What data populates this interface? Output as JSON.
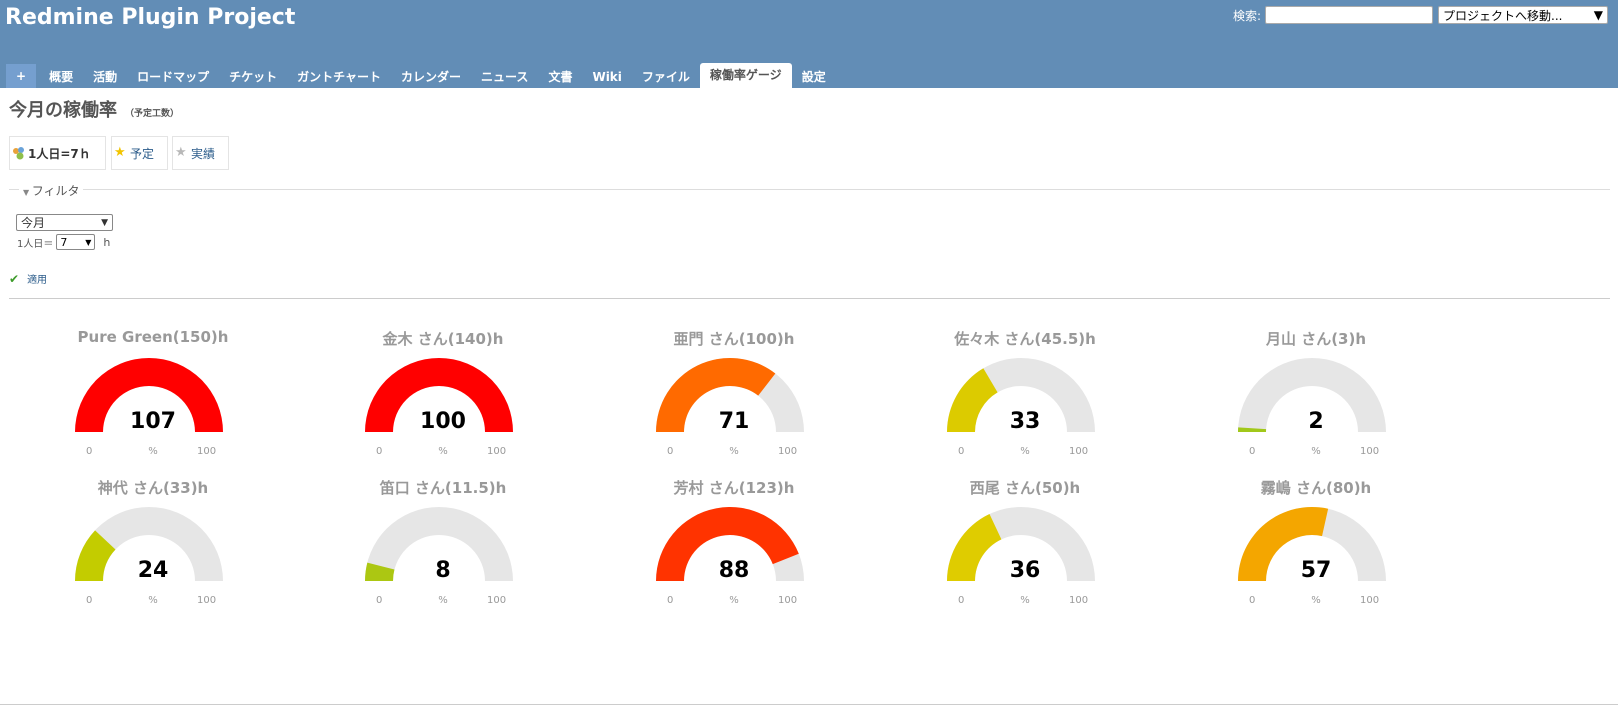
{
  "header": {
    "title": "Redmine Plugin Project",
    "search_label": "検索:",
    "search_value": "",
    "jump_label": "プロジェクトへ移動...",
    "bg_color": "#628db6"
  },
  "menu": {
    "plus_label": "+",
    "tabs": [
      "概要",
      "活動",
      "ロードマップ",
      "チケット",
      "ガントチャート",
      "カレンダー",
      "ニュース",
      "文書",
      "Wiki",
      "ファイル",
      "稼働率ゲージ",
      "設定"
    ],
    "selected": "稼働率ゲージ"
  },
  "page": {
    "title": "今月の稼働率",
    "subtitle": "（予定工数）",
    "unit_box": "1人日=7ｈ",
    "plan_box": "予定",
    "actual_box": "実績"
  },
  "filter": {
    "legend": "フィルタ",
    "period": "今月",
    "per_day_label": "1人日＝",
    "hours": "7",
    "hours_unit": "h",
    "apply_label": "適用"
  },
  "gauge_labels": {
    "min": "0",
    "unit": "%",
    "max": "100"
  },
  "gauges": [
    {
      "title": "Pure Green(150)h",
      "value": 107,
      "color": "#ff0000"
    },
    {
      "title": "金木 さん(140)h",
      "value": 100,
      "color": "#ff0000"
    },
    {
      "title": "亜門 さん(100)h",
      "value": 71,
      "color": "#ff6a00"
    },
    {
      "title": "佐々木 さん(45.5)h",
      "value": 33,
      "color": "#dccb00"
    },
    {
      "title": "月山 さん(3)h",
      "value": 2,
      "color": "#a1c81a"
    },
    {
      "title": "神代 さん(33)h",
      "value": 24,
      "color": "#c3cc00"
    },
    {
      "title": "笛口 さん(11.5)h",
      "value": 8,
      "color": "#acc712"
    },
    {
      "title": "芳村 さん(123)h",
      "value": 88,
      "color": "#ff3300"
    },
    {
      "title": "西尾 さん(50)h",
      "value": 36,
      "color": "#dfcc00"
    },
    {
      "title": "霧嶋 さん(80)h",
      "value": 57,
      "color": "#f4a600"
    }
  ]
}
